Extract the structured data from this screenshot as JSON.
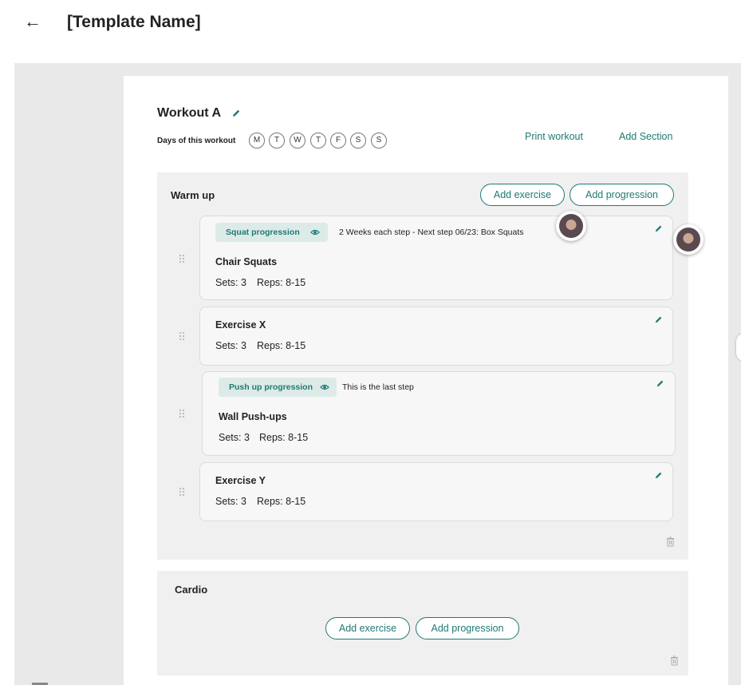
{
  "header": {
    "back_icon": "arrow-left-icon",
    "title": "[Template Name]"
  },
  "workout": {
    "title": "Workout A",
    "days_label": "Days of this workout",
    "days": [
      "M",
      "T",
      "W",
      "T",
      "F",
      "S",
      "S"
    ],
    "print_label": "Print workout",
    "add_section_label": "Add Section"
  },
  "sections": {
    "warmup": {
      "title": "Warm up",
      "add_exercise": "Add exercise",
      "add_progression": "Add progression",
      "items": [
        {
          "progression": "Squat progression",
          "note": "2 Weeks each step - Next step 06/23: Box Squats",
          "name": "Chair Squats",
          "sets": "Sets: 3",
          "reps": "Reps: 8-15"
        },
        {
          "name": "Exercise X",
          "sets": "Sets: 3",
          "reps": "Reps: 8-15"
        },
        {
          "progression": "Push up progression",
          "note": "This is the last step",
          "name": "Wall Push-ups",
          "sets": "Sets: 3",
          "reps": "Reps: 8-15"
        },
        {
          "name": "Exercise Y",
          "sets": "Sets: 3",
          "reps": "Reps: 8-15"
        }
      ]
    },
    "cardio": {
      "title": "Cardio",
      "add_exercise": "Add exercise",
      "add_progression": "Add progression"
    }
  },
  "colors": {
    "accent": "#1f7a73",
    "chip_bg": "#dcebe8",
    "section_bg": "#f0f0f0",
    "canvas_bg": "#e9e9e9"
  }
}
